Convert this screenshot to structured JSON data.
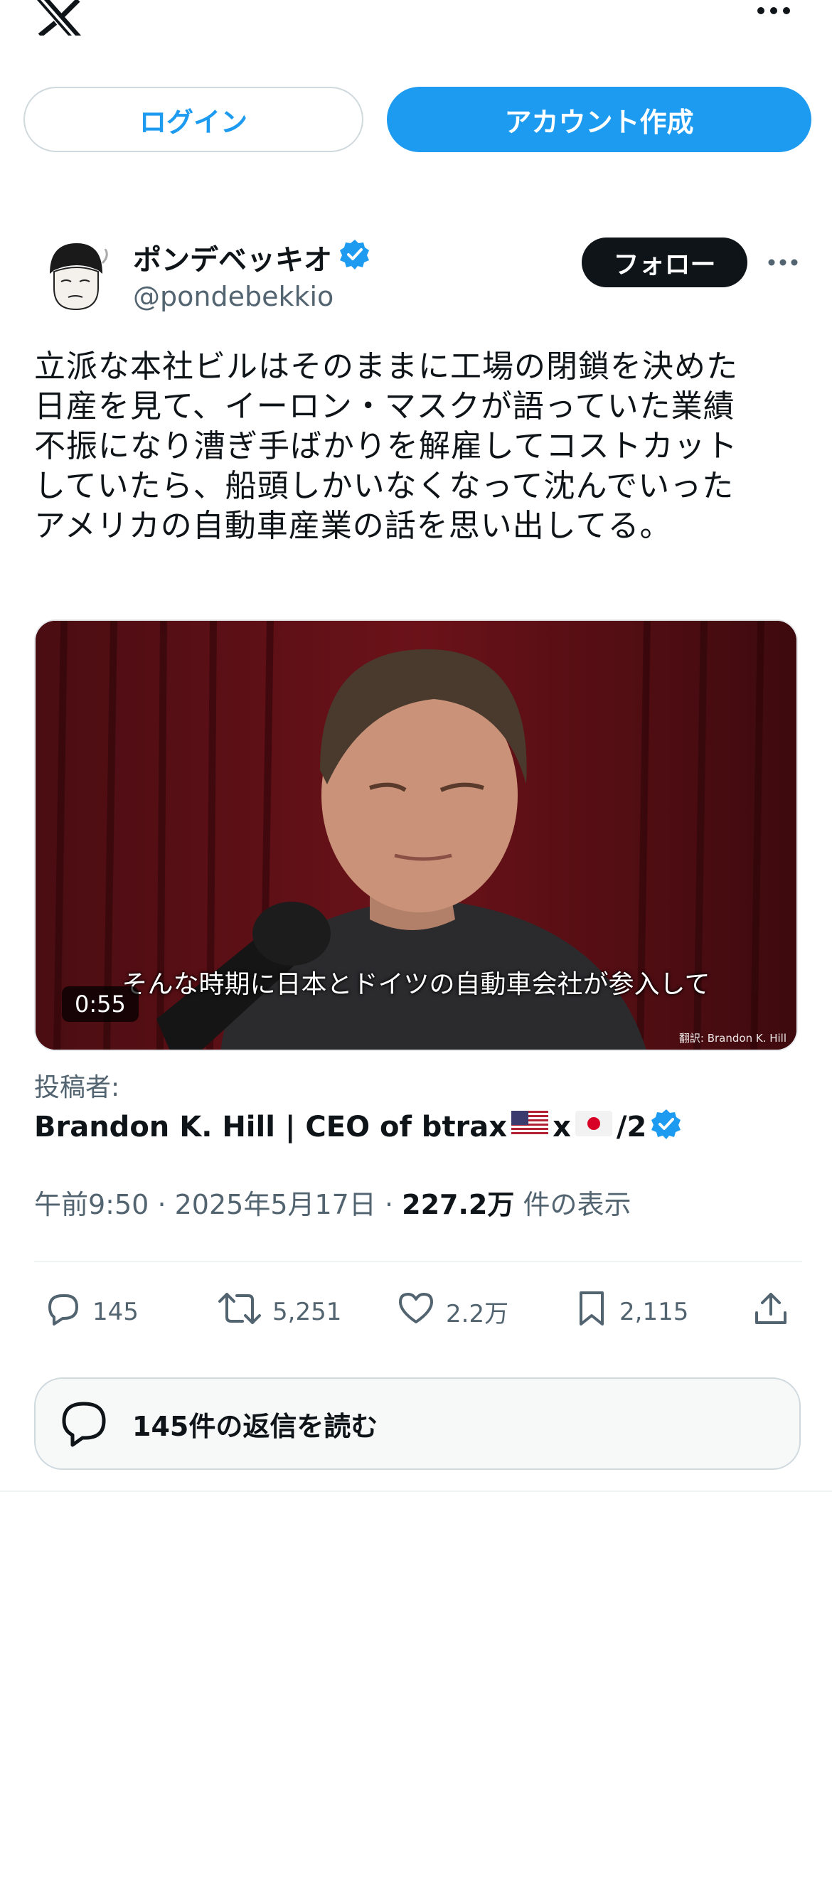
{
  "header": {
    "logo_icon": "x-logo-icon",
    "more_icon": "more-horizontal-icon",
    "login_label": "ログイン",
    "signup_label": "アカウント作成"
  },
  "post": {
    "author": {
      "name": "ポンデベッキオ",
      "handle": "@pondebekkio",
      "verified_icon": "verified-badge-icon"
    },
    "follow_label": "フォロー",
    "text": "立派な本社ビルはそのままに工場の閉鎖を決めた\n日産を見て、イーロン・マスクが語っていた業績\n不振になり漕ぎ手ばかりを解雇してコストカット\nしていたら、船頭しかいなくなって沈んでいった\nアメリカの自動車産業の話を思い出してる。",
    "media": {
      "subtitle": "そんな時期に日本とドイツの自動車会社が参入して",
      "duration": "0:55",
      "watermark": "翻訳: Brandon K. Hill"
    },
    "posted_by_label": "投稿者:",
    "posted_by_name": "Brandon K. Hill | CEO of btrax",
    "posted_by_suffix_x": "x",
    "posted_by_suffix_tail": "/2",
    "time": "午前9:50",
    "sep": "·",
    "date": "2025年5月17日",
    "views_count": "227.2万",
    "views_label": "件の表示",
    "actions": {
      "replies": "145",
      "retweets": "5,251",
      "likes": "2.2万",
      "bookmarks": "2,115"
    },
    "read_replies_label": "145件の返信を読む"
  },
  "colors": {
    "accent": "#1d9bf0",
    "text": "#0f1419",
    "secondary": "#536471",
    "border": "#cfd9de"
  }
}
